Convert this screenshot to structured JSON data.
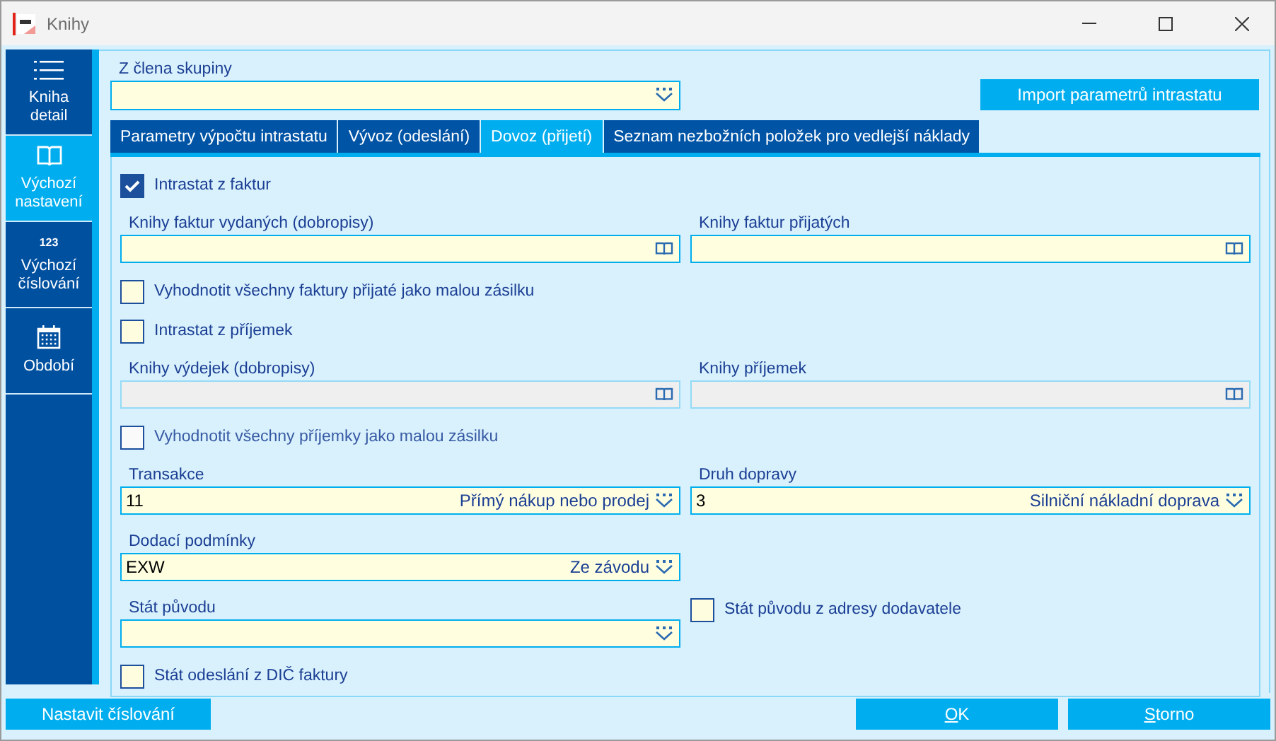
{
  "window": {
    "title": "Knihy"
  },
  "sidebar": {
    "items": [
      {
        "label": "Kniha detail",
        "kind": "menu",
        "selected": false
      },
      {
        "label": "Výchozí nastavení",
        "kind": "book",
        "selected": true
      },
      {
        "label": "Výchozí číslování",
        "kind": "numbers",
        "icon_text": "123",
        "selected": false
      },
      {
        "label": "Období",
        "kind": "calendar",
        "selected": false
      }
    ]
  },
  "group_member": {
    "label": "Z člena skupiny",
    "kind": "dropdown-field"
  },
  "import_button": "Import parametrů intrastatu",
  "tabs": [
    {
      "label": "Parametry výpočtu intrastatu",
      "selected": false
    },
    {
      "label": "Vývoz (odeslání)",
      "selected": false
    },
    {
      "label": "Dovoz (přijetí)",
      "selected": true
    },
    {
      "label": "Seznam nezbožních položek pro vedlejší náklady",
      "selected": false
    }
  ],
  "rows": [
    {
      "left": {
        "kind": "checkbox",
        "label": "Intrastat z faktur",
        "checked": true
      }
    },
    {
      "left": {
        "kind": "lookup-field",
        "label": "Knihy faktur vydaných (dobropisy)",
        "disabled": false
      },
      "right": {
        "kind": "lookup-field",
        "label": "Knihy faktur přijatých",
        "disabled": false
      }
    },
    {
      "left": {
        "kind": "checkbox",
        "label": "Vyhodnotit všechny faktury přijaté jako malou zásilku",
        "checked": false,
        "disabled": false
      }
    },
    {
      "left": {
        "kind": "checkbox",
        "label": "Intrastat z příjemek",
        "checked": false,
        "disabled": false
      }
    },
    {
      "left": {
        "kind": "lookup-field",
        "label": "Knihy výdejek (dobropisy)",
        "disabled": true
      },
      "right": {
        "kind": "lookup-field",
        "label": "Knihy příjemek",
        "disabled": true
      }
    },
    {
      "left": {
        "kind": "checkbox",
        "label": "Vyhodnotit všechny příjemky jako malou zásilku",
        "checked": false,
        "disabled": true
      }
    },
    {
      "left": {
        "kind": "dropdown-field",
        "label": "Transakce",
        "value": "11",
        "description": "Přímý nákup nebo prodej",
        "disabled": false
      },
      "right": {
        "kind": "dropdown-field",
        "label": "Druh dopravy",
        "value": "3",
        "description": "Silniční nákladní doprava",
        "disabled": false
      }
    },
    {
      "left": {
        "kind": "dropdown-field",
        "label": "Dodací podmínky",
        "value": "EXW",
        "description": "Ze závodu",
        "disabled": false
      }
    },
    {
      "left": {
        "kind": "dropdown-field",
        "label": "Stát původu",
        "disabled": false
      },
      "right": {
        "kind": "checkbox",
        "label": "Stát původu z adresy dodavatele",
        "checked": false,
        "disabled": false
      }
    },
    {
      "left": {
        "kind": "checkbox",
        "label": "Stát odeslání z DIČ faktury",
        "checked": false,
        "disabled": false
      }
    }
  ],
  "footer": {
    "left_button": {
      "label": "Nastavit číslování"
    },
    "buttons": [
      {
        "label": "OK",
        "underline_first": true
      },
      {
        "label": "Storno",
        "underline_first": true
      }
    ]
  }
}
